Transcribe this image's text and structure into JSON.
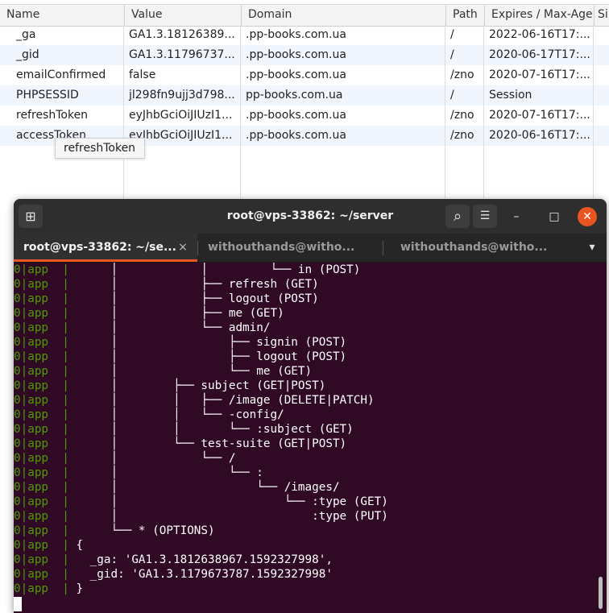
{
  "cookies": {
    "columns": [
      "Name",
      "Value",
      "Domain",
      "Path",
      "Expires / Max-Age",
      "Si"
    ],
    "rows": [
      [
        "_ga",
        "GA1.3.18126389...",
        ".pp-books.com.ua",
        "/",
        "2022-06-16T17:..."
      ],
      [
        "_gid",
        "GA1.3.11796737...",
        ".pp-books.com.ua",
        "/",
        "2020-06-17T17:..."
      ],
      [
        "emailConfirmed",
        "false",
        ".pp-books.com.ua",
        "/zno",
        "2020-07-16T17:..."
      ],
      [
        "PHPSESSID",
        "jl298fn9ujj3d798...",
        "pp-books.com.ua",
        "/",
        "Session"
      ],
      [
        "refreshToken",
        "eyJhbGciOiJIUzI1...",
        ".pp-books.com.ua",
        "/zno",
        "2020-07-16T17:..."
      ],
      [
        "accessToken",
        "eyJhbGciOiJIUzI1...",
        ".pp-books.com.ua",
        "/zno",
        "2020-06-16T17:..."
      ]
    ],
    "tooltip": "refreshToken"
  },
  "terminal": {
    "title": "root@vps-33862: ~/server",
    "tabs": [
      {
        "label": "root@vps-33862: ~/se...",
        "active": true
      },
      {
        "label": "withouthands@witho...",
        "active": false
      },
      {
        "label": "withouthands@witho...",
        "active": false
      }
    ],
    "line_prefix": "0|app  | ",
    "lines": [
      "     │            │         └── in (POST)",
      "     │            ├── refresh (GET)",
      "     │            ├── logout (POST)",
      "     │            ├── me (GET)",
      "     │            └── admin/",
      "     │                ├── signin (POST)",
      "     │                ├── logout (POST)",
      "     │                └── me (GET)",
      "     │        ├── subject (GET|POST)",
      "     │        │   ├── /image (DELETE|PATCH)",
      "     │        │   └── -config/",
      "     │        │       └── :subject (GET)",
      "     │        └── test-suite (GET|POST)",
      "     │            └── /",
      "     │                └── :",
      "     │                    └── /images/",
      "     │                        └── :type (GET)",
      "     │                            :type (PUT)",
      "     └── * (OPTIONS)",
      "{",
      "  _ga: 'GA1.3.1812638967.1592327998',",
      "  _gid: 'GA1.3.1179673787.1592327998'",
      "}"
    ]
  },
  "icons": {
    "new_tab": "⊞",
    "search": "⌕",
    "menu": "☰",
    "minimize": "–",
    "maximize": "□",
    "close": "✕",
    "tab_close": "×",
    "tab_dropdown": "▾"
  },
  "colors": {
    "terminal_bg": "#300a24",
    "prompt_green": "#4e9a06",
    "tab_accent": "#e95420",
    "close_button": "#e95420",
    "row_alt": "#f1f5fd"
  }
}
